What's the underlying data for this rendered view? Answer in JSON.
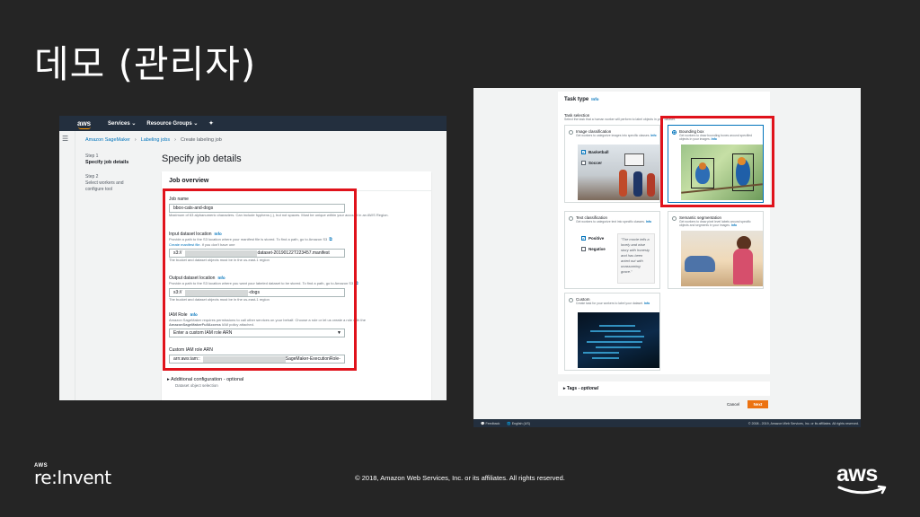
{
  "slide": {
    "title": "데모 (관리자)",
    "copyright": "© 2018, Amazon Web Services, Inc. or its affiliates. All rights reserved.",
    "reinvent_small": "AWS",
    "reinvent_big": "re:Invent",
    "aws_logo_text": "aws"
  },
  "left_console": {
    "logo": "aws",
    "nav": [
      "Services ⌄",
      "Resource Groups ⌄",
      "✦"
    ],
    "breadcrumb": [
      "Amazon SageMaker",
      "Labeling jobs",
      "Create labeling job"
    ],
    "steps": [
      {
        "step": "Step 1",
        "title": "Specify job details"
      },
      {
        "step": "Step 2",
        "title": "Select workers and configure tool"
      }
    ],
    "page_title": "Specify job details",
    "panel_title": "Job overview",
    "job_name": {
      "label": "Job name",
      "value": "bbox-cats-and-dogs",
      "desc": "Maximum of 63 alphanumeric characters. Can include hyphens (-), but not spaces. Must be unique within your account in an AWS Region."
    },
    "input_location": {
      "label": "Input dataset location",
      "info": "Info",
      "desc": "Provide a path to the S3 location where your manifest file is stored. To find a path, go to Amazon S3",
      "create_link": "Create manifest file.",
      "create_suffix": "if you don't have one",
      "prefix": "s3://",
      "suffix": "dataset-20190122T223457.manifest",
      "note": "The bucket and dataset objects must be in the us-east-1 region"
    },
    "output_location": {
      "label": "Output dataset location",
      "info": "Info",
      "desc": "Provide a path to the S3 location where you want your labeled dataset to be stored. To find a path, go to Amazon S3",
      "prefix": "s3://",
      "suffix": "-dogs",
      "note": "The bucket and dataset objects must be in the us-east-1 region"
    },
    "iam_role": {
      "label": "IAM Role",
      "info": "Info",
      "desc": "Amazon SageMaker requires permissions to call other services on your behalf. Choose a role or let us create a role with the",
      "policy": "AmazonSageMakerFullAccess",
      "policy_suffix": "IAM policy attached.",
      "selected": "Enter a custom IAM role ARN"
    },
    "custom_arn": {
      "label": "Custom IAM role ARN",
      "prefix": "arn:aws:iam::",
      "suffix": "SageMaker-ExecutionRole-"
    },
    "additional": {
      "label": "Additional configuration - optional",
      "sub": "Dataset object selection"
    }
  },
  "right_console": {
    "task_type": "Task type",
    "info": "Info",
    "task_selection": "Task selection",
    "task_selection_desc": "Select the task that a human worker will perform to label objects in your dataset.",
    "cards": [
      {
        "title": "Image classification",
        "desc": "Get workers to categorize images into specific classes.",
        "selected": false
      },
      {
        "title": "Bounding box",
        "desc": "Get workers to draw bounding boxes around specified objects in your images.",
        "selected": true
      },
      {
        "title": "Text classification",
        "desc": "Get workers to categorize text into specific classes.",
        "selected": false
      },
      {
        "title": "Semantic segmentation",
        "desc": "Get workers to draw pixel level labels around specific objects and segments in your images.",
        "selected": false
      },
      {
        "title": "Custom",
        "desc": "Create task for your workers to label your dataset.",
        "selected": false
      }
    ],
    "image_class_labels": [
      "Basketball",
      "Soccer"
    ],
    "text_class_labels": [
      "Positive",
      "Negative"
    ],
    "quote": "\"The movie tells a lovely and wise story with honesty and has been acted out with unassuming grace.\"",
    "tags_label": "Tags - ",
    "tags_optional": "optional",
    "cancel": "Cancel",
    "next": "Next",
    "footer_feedback": "Feedback",
    "footer_lang": "English (US)",
    "footer_copyright": "© 2008 - 2019, Amazon Web Services, Inc. or its affiliates. All rights reserved."
  },
  "colors": {
    "slide_bg": "#252525",
    "highlight": "#e0121b",
    "aws_orange": "#ff9900",
    "link": "#0073bb",
    "next_button": "#ec7211"
  }
}
